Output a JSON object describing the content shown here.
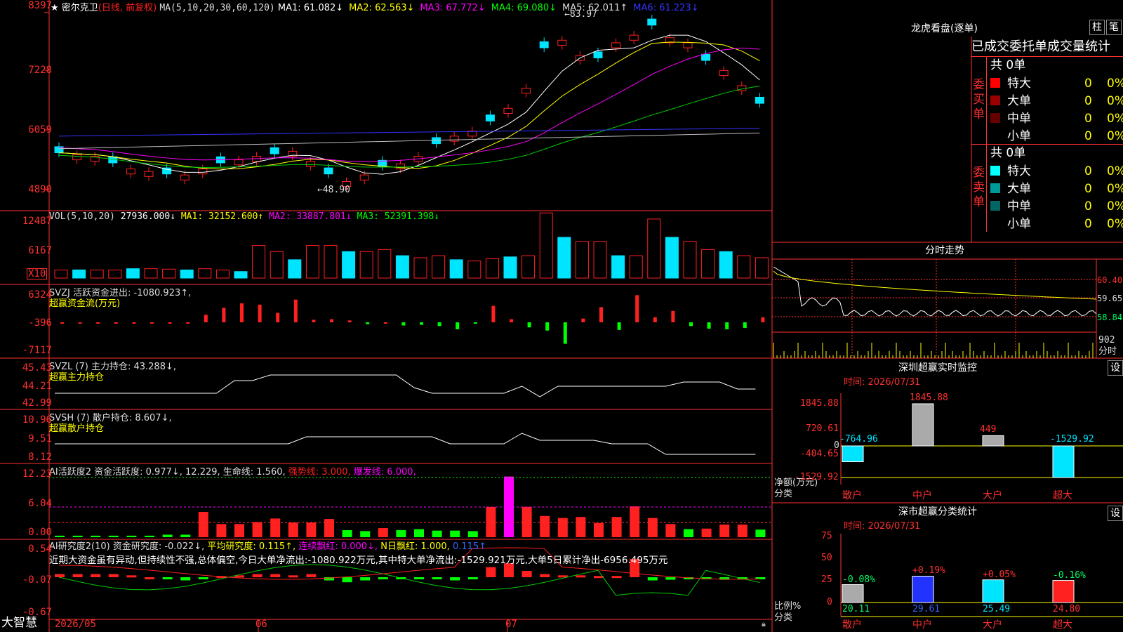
{
  "stock": {
    "name": "密尔克卫",
    "period": "(日线, 前复权)",
    "ma_label": "MA(5,10,20,30,60,120)",
    "ma": [
      {
        "label": "MA1: 61.082↓",
        "color": "#ffffff"
      },
      {
        "label": "MA2: 62.563↓",
        "color": "#ffff00"
      },
      {
        "label": "MA3: 67.772↓",
        "color": "#ff00ff"
      },
      {
        "label": "MA4: 69.080↓",
        "color": "#00ff00"
      },
      {
        "label": "MA5: 62.011↑",
        "color": "#dddddd"
      },
      {
        "label": "MA6: 61.223↓",
        "color": "#3333ff"
      }
    ],
    "high_label": "83.97",
    "low_label": "48.90",
    "price_axis": [
      "8397",
      "7228",
      "6059",
      "4890"
    ]
  },
  "volume": {
    "header": "VOL(5,10,20)",
    "value": "27936.000↓",
    "ma": [
      {
        "label": "MA1: 32152.600↑",
        "color": "#ffff00"
      },
      {
        "label": "MA2: 33887.801↓",
        "color": "#ff00ff"
      },
      {
        "label": "MA3: 52391.398↓",
        "color": "#00ff00"
      }
    ],
    "axis": [
      "12487",
      "6167"
    ],
    "unit": "X10",
    "colors": {
      "up": "#ff2020",
      "down": "#00e5ff"
    }
  },
  "svzj": {
    "header": "SVZJ  活跃资金进出: -1080.923↑,",
    "subtitle": "超赢资金流(万元)",
    "axis": [
      "6324",
      "-396",
      "-7117"
    ]
  },
  "svzl": {
    "header": "SVZL (7) 主力持仓: 43.288↓,",
    "subtitle": "超赢主力持仓",
    "axis": [
      "45.43",
      "44.21",
      "42.99"
    ]
  },
  "svsh": {
    "header": "SVSH (7) 散户持仓: 8.607↓,",
    "subtitle": "超赢散户持仓",
    "axis": [
      "10.96",
      "9.51",
      "8.12"
    ]
  },
  "ai1": {
    "header": "AI活跃度2 资金活跃度: 0.977↓, 12.229, 生命线: 1.560,",
    "strong": "强势线: 3.000,",
    "burst": "爆发线: 6.000,",
    "axis": [
      "12.23",
      "6.04",
      "0.00"
    ]
  },
  "ai2": {
    "header_a": "AI研究度2(10) 资金研究度: -0.022↓,",
    "header_b": "平均研究度: 0.115↑,",
    "header_c": "连续飘红: 0.000↓,",
    "header_d": "N日飘红: 1.000,",
    "header_e": "0.115↑",
    "comment": "近期大资金虽有异动,但持续性不强,总体偏空,今日大单净流出:-1080.922万元,其中特大单净流出:-1529.921万元,大单5日累计净出-6956.495万元",
    "axis": [
      "0.54",
      "-0.07",
      "-0.67"
    ]
  },
  "date_axis": [
    "2026/05",
    "06",
    "07"
  ],
  "brand": "大智慧",
  "right": {
    "btn_zhu": "柱",
    "btn_bi": "笔",
    "lhb_title": "龙虎看盘(逐单)",
    "stat_title": "已成交委托单成交量统计",
    "buy_side": "委买单",
    "sell_side": "委卖单",
    "buy_total": "共 0单",
    "sell_total": "共 0单",
    "buy_rows": [
      {
        "name": "特大",
        "count": "0",
        "pct": "0%",
        "color": "#ff0000"
      },
      {
        "name": "大单",
        "count": "0",
        "pct": "0%",
        "color": "#990000"
      },
      {
        "name": "中单",
        "count": "0",
        "pct": "0%",
        "color": "#660000"
      },
      {
        "name": "小单",
        "count": "0",
        "pct": "0%",
        "color": ""
      }
    ],
    "sell_rows": [
      {
        "name": "特大",
        "count": "0",
        "pct": "0%",
        "color": "#00ffff"
      },
      {
        "name": "大单",
        "count": "0",
        "pct": "0%",
        "color": "#009999"
      },
      {
        "name": "中单",
        "count": "0",
        "pct": "0%",
        "color": "#006666"
      },
      {
        "name": "小单",
        "count": "0",
        "pct": "0%",
        "color": ""
      }
    ],
    "intraday_title": "分时走势",
    "intraday_axis": [
      "60.40",
      "59.65",
      "58.84"
    ],
    "intraday_vol": "902",
    "intraday_vol_unit": "分时",
    "monitor_title": "深圳超赢实时监控",
    "settings": "设",
    "monitor_time": "时间: 2026/07/31",
    "monitor_axis": [
      "1845.88",
      "720.61",
      "0",
      "-404.65",
      "-1529.92"
    ],
    "monitor_ylabel": "净额(万元)",
    "monitor_xlabel": "分类",
    "categories": [
      "散户",
      "中户",
      "大户",
      "超大"
    ],
    "monitor_values": [
      "-764.96",
      "1845.88",
      "449",
      "-1529.92"
    ],
    "class_title": "深市超赢分类统计",
    "class_time": "时间: 2026/07/31",
    "class_axis": [
      "75",
      "50",
      "25",
      "0"
    ],
    "class_ylabel": "比例%",
    "class_xlabel": "分类",
    "class_values": [
      "20.11",
      "29.61",
      "25.49",
      "24.80"
    ],
    "class_changes": [
      "-0.08%",
      "+0.19%",
      "+0.05%",
      "-0.16%"
    ]
  },
  "chart_data": [
    {
      "type": "bar",
      "title": "深圳超赢实时监控",
      "categories": [
        "散户",
        "中户",
        "大户",
        "超大"
      ],
      "values": [
        -764.96,
        1845.88,
        449,
        -1529.92
      ],
      "ylabel": "净额(万元)",
      "ylim": [
        -1529.92,
        1845.88
      ]
    },
    {
      "type": "bar",
      "title": "深市超赢分类统计",
      "categories": [
        "散户",
        "中户",
        "大户",
        "超大"
      ],
      "values": [
        20.11,
        29.61,
        25.49,
        24.8
      ],
      "ylabel": "比例%",
      "ylim": [
        0,
        75
      ]
    }
  ]
}
